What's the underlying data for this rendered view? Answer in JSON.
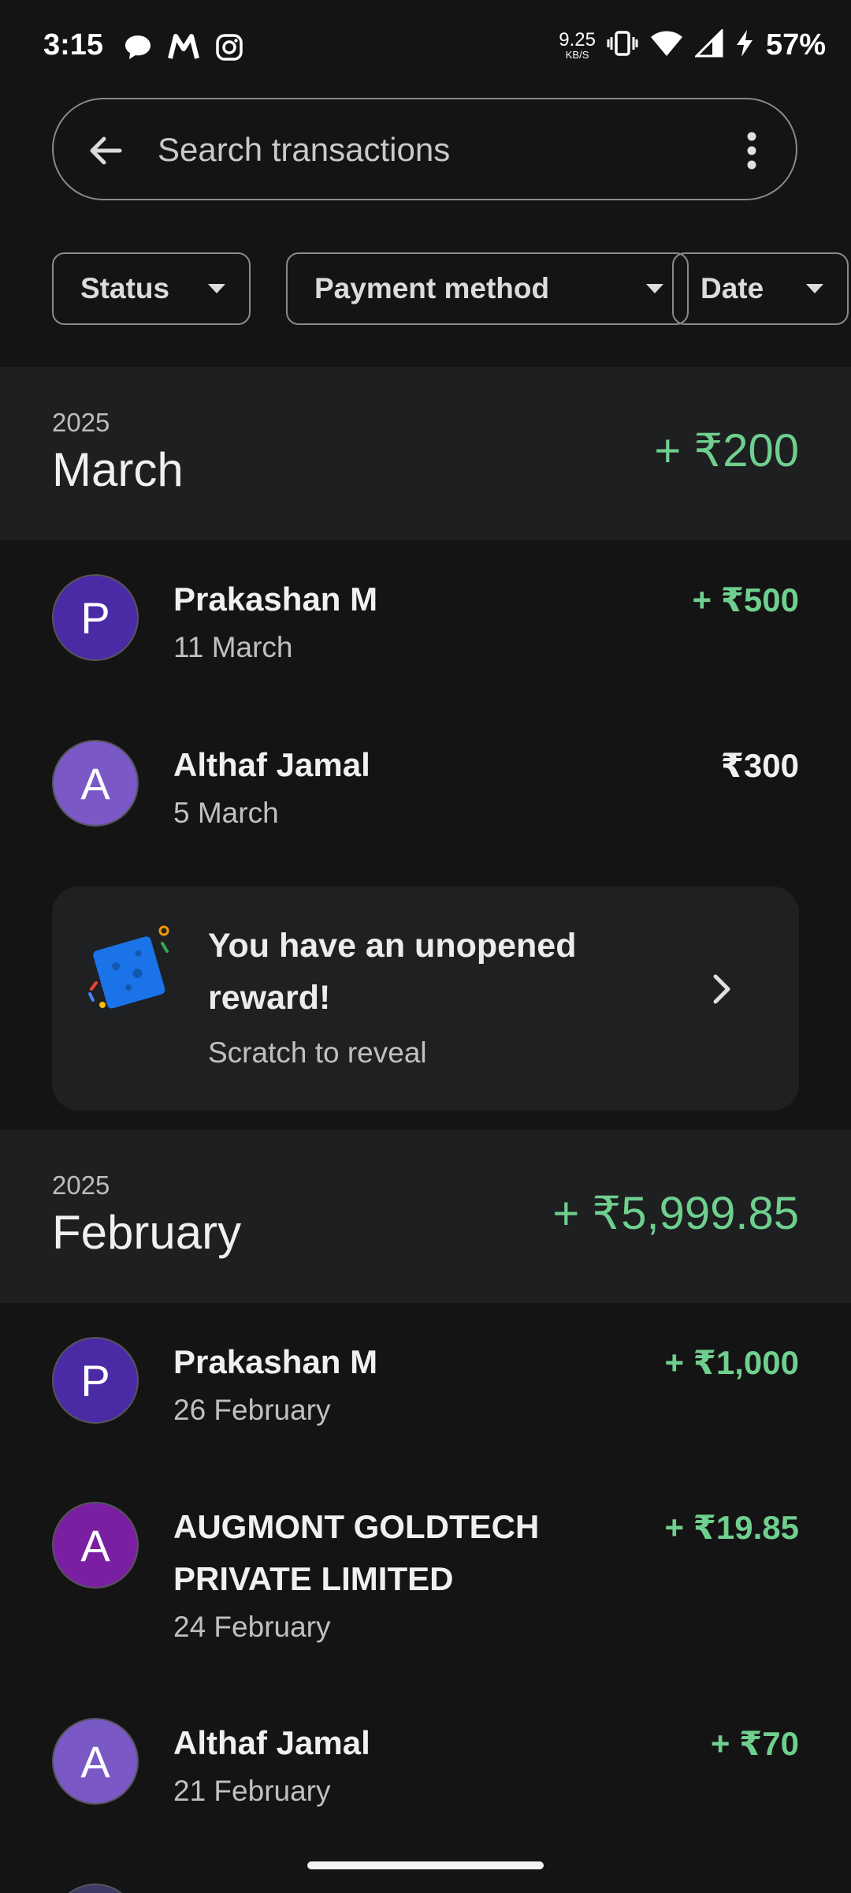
{
  "status_bar": {
    "time": "3:15",
    "app_icons": [
      "chat-bubble-icon",
      "myntra-icon",
      "instagram-icon"
    ],
    "net_speed_value": "9.25",
    "net_speed_unit": "KB/S",
    "battery_percent": "57%"
  },
  "search": {
    "placeholder": "Search transactions"
  },
  "filters": [
    {
      "label": "Status"
    },
    {
      "label": "Payment method"
    },
    {
      "label": "Date"
    }
  ],
  "months": [
    {
      "year": "2025",
      "month": "March",
      "total": "+ ₹200",
      "transactions": [
        {
          "initial": "P",
          "name": "Prakashan M",
          "date": "11 March",
          "amount": "+ ₹500",
          "color": "#4b2aa6"
        },
        {
          "initial": "A",
          "name": "Althaf Jamal",
          "date": "5 March",
          "amount": "₹300",
          "color": "#7a58c6"
        }
      ]
    },
    {
      "year": "2025",
      "month": "February",
      "total": "+ ₹5,999.85",
      "transactions": [
        {
          "initial": "P",
          "name": "Prakashan M",
          "date": "26 February",
          "amount": "+ ₹1,000",
          "color": "#4b2aa6"
        },
        {
          "initial": "A",
          "name": "AUGMONT GOLDTECH PRIVATE LIMITED",
          "date": "24 February",
          "amount": "+ ₹19.85",
          "color": "#7b1fa2"
        },
        {
          "initial": "A",
          "name": "Althaf Jamal",
          "date": "21 February",
          "amount": "+ ₹70",
          "color": "#7a58c6"
        }
      ]
    }
  ],
  "reward": {
    "title": "You have an unopened reward!",
    "subtitle": "Scratch to reveal"
  },
  "colors": {
    "positive": "#6fcf8e",
    "background": "#141414",
    "header_bg": "#1e1f21"
  }
}
